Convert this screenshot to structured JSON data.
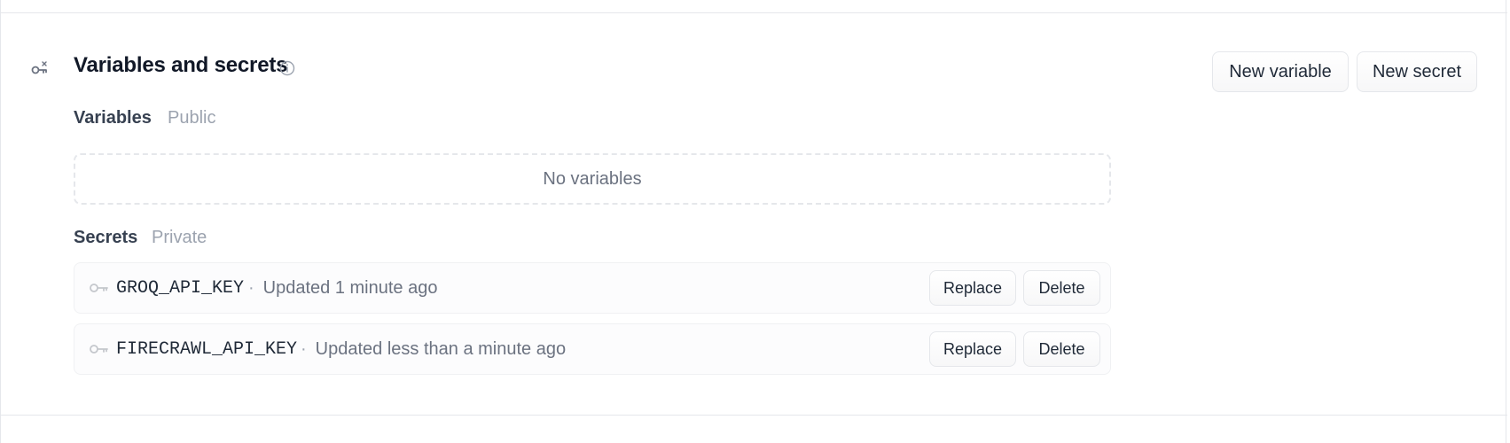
{
  "section": {
    "title": "Variables and secrets",
    "icon": "settings-key-icon",
    "info_icon": "info-icon"
  },
  "actions": {
    "new_variable": "New variable",
    "new_secret": "New secret"
  },
  "variables": {
    "label": "Variables",
    "tag": "Public",
    "empty_text": "No variables"
  },
  "secrets": {
    "label": "Secrets",
    "tag": "Private",
    "separator": "·",
    "items": [
      {
        "name": "GROQ_API_KEY",
        "updated": "Updated 1 minute ago",
        "replace_label": "Replace",
        "delete_label": "Delete"
      },
      {
        "name": "FIRECRAWL_API_KEY",
        "updated": "Updated less than a minute ago",
        "replace_label": "Replace",
        "delete_label": "Delete"
      }
    ]
  },
  "colors": {
    "border": "#e5e7eb",
    "muted_text": "#6b7280",
    "tag_text": "#9ca3af"
  }
}
